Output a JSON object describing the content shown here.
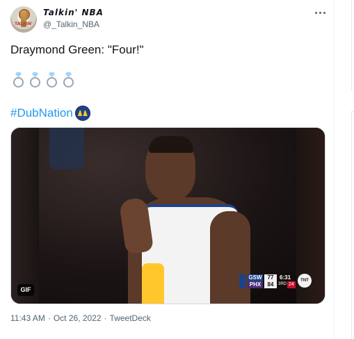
{
  "author": {
    "display_name": "Talkin' NBA",
    "handle": "@_Talkin_NBA",
    "avatar_text": "TALKIN'",
    "more_icon": "more-horizontal-icon"
  },
  "tweet": {
    "text": "Draymond Green: \"Four!\"",
    "emojis": [
      "ring-icon",
      "ring-icon",
      "ring-icon",
      "ring-icon"
    ],
    "hashtag": "#DubNation",
    "hashtag_icon": "warriors-logo-icon"
  },
  "media": {
    "badge": "GIF",
    "scorebug": {
      "home_team": "GSW",
      "home_score": "77",
      "away_team": "PHX",
      "away_score": "84",
      "clock": "6:31",
      "quarter": "3RD",
      "shot_clock": "24",
      "network": "TNT"
    }
  },
  "meta": {
    "time": "11:43 AM",
    "separator": "·",
    "date": "Oct 26, 2022",
    "source": "TweetDeck"
  },
  "colors": {
    "link": "#1d9bf0",
    "secondary_text": "#536471",
    "warriors_blue": "#1d428a",
    "warriors_gold": "#ffc72c"
  }
}
